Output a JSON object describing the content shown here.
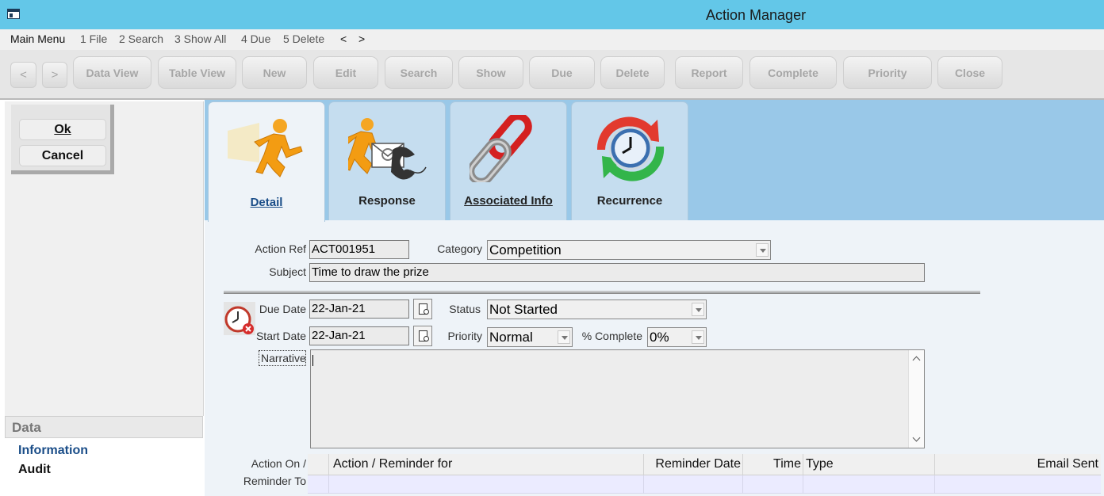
{
  "window": {
    "title": "Action Manager",
    "icon": "app-icon"
  },
  "menu": {
    "items": [
      "Main Menu",
      "1 File",
      "2 Search",
      "3 Show All",
      "4 Due",
      "5 Delete",
      "<",
      ">"
    ]
  },
  "toolbar": {
    "prev": "<",
    "next": ">",
    "buttons": [
      "Data View",
      "Table View",
      "New",
      "Edit",
      "Search",
      "Show",
      "Due",
      "Delete",
      "Report",
      "Complete",
      "Priority",
      "Close"
    ]
  },
  "dialog": {
    "ok": "Ok",
    "cancel": "Cancel"
  },
  "data_panel": {
    "header": "Data",
    "items": [
      "Information",
      "Audit"
    ]
  },
  "tabs": [
    {
      "label": "Detail",
      "icon": "running-man-icon",
      "active": true
    },
    {
      "label": "Response",
      "icon": "running-man-phone-icon",
      "active": false
    },
    {
      "label": "Associated Info",
      "icon": "chain-link-icon",
      "active": false
    },
    {
      "label": "Recurrence",
      "icon": "clock-recurrence-icon",
      "active": false
    }
  ],
  "form": {
    "action_ref_label": "Action Ref",
    "action_ref": "ACT001951",
    "category_label": "Category",
    "category": "Competition",
    "subject_label": "Subject",
    "subject": "Time to draw the prize",
    "due_date_label": "Due Date",
    "due_date": "22-Jan-21",
    "start_date_label": "Start Date",
    "start_date": "22-Jan-21",
    "status_label": "Status",
    "status": "Not Started",
    "priority_label": "Priority",
    "priority": "Normal",
    "complete_label": "% Complete",
    "complete": "0%",
    "narrative_label": "Narrative",
    "narrative": ""
  },
  "grid": {
    "left_label_1": "Action On /",
    "left_label_2": "Reminder To",
    "columns": [
      "Action / Reminder for",
      "Reminder Date",
      "Time",
      "Type",
      "Email Sent"
    ]
  },
  "colors": {
    "titlebar": "#63c7e8",
    "tabstrip": "#99c8e8",
    "active_tab_text": "#1a4d88",
    "grid_row": "#ebebff"
  }
}
